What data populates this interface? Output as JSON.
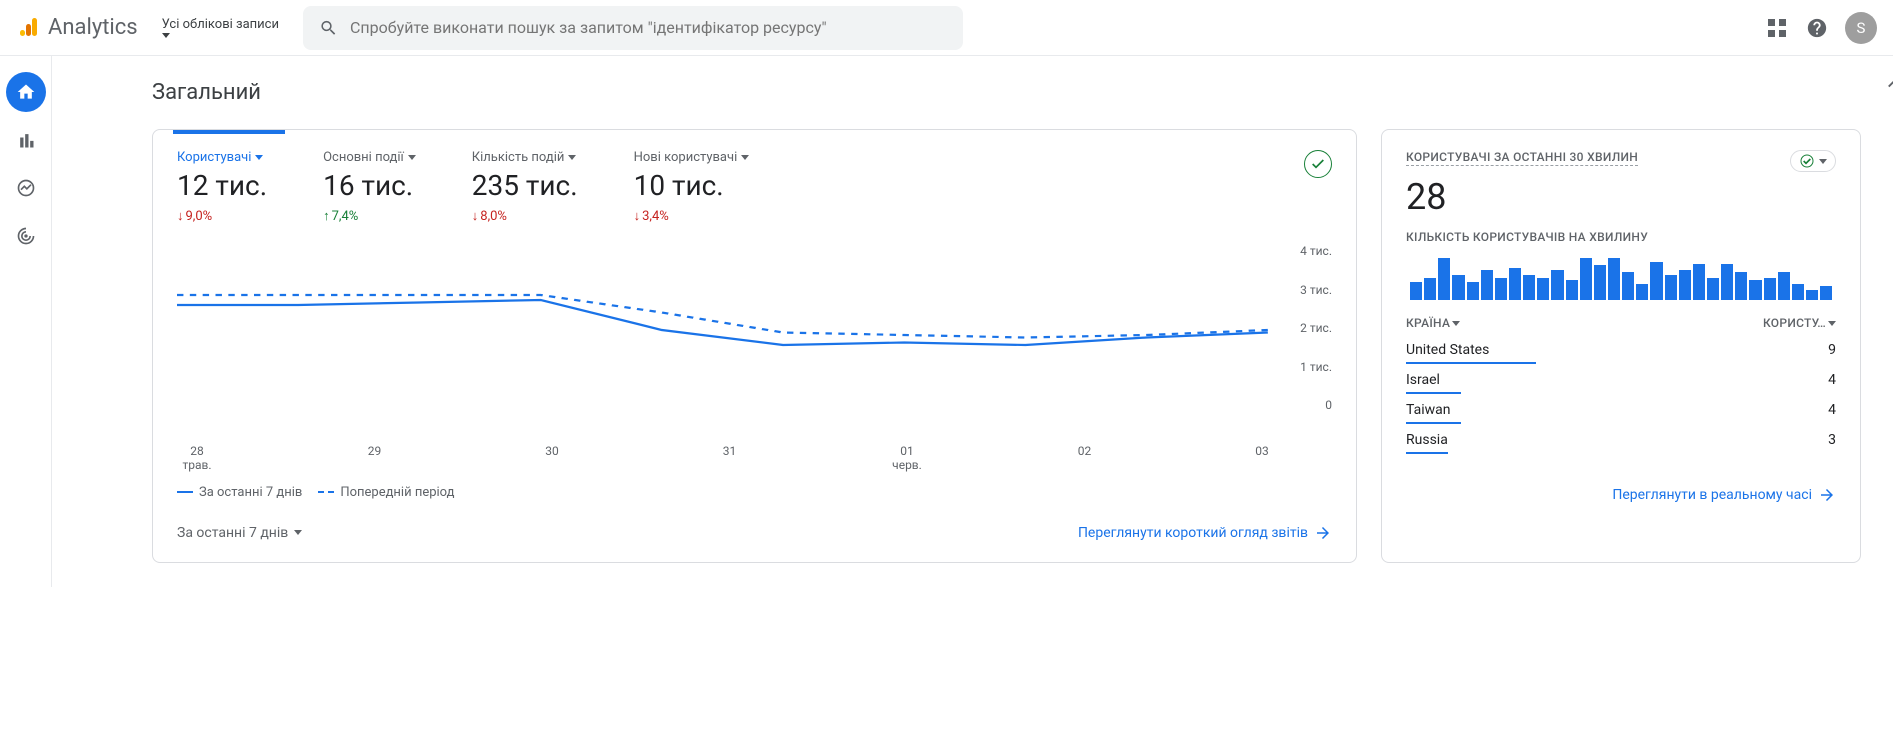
{
  "header": {
    "brand": "Analytics",
    "account_label": "Усі облікові записи",
    "search_placeholder": "Спробуйте виконати пошук за запитом \"ідентифікатор ресурсу\"",
    "avatar_initial": "S"
  },
  "page": {
    "title": "Загальний"
  },
  "metrics": [
    {
      "label": "Користувачі",
      "value": "12 тис.",
      "delta": "9,0%",
      "dir": "down",
      "active": true
    },
    {
      "label": "Основні події",
      "value": "16 тис.",
      "delta": "7,4%",
      "dir": "up",
      "active": false
    },
    {
      "label": "Кількість подій",
      "value": "235 тис.",
      "delta": "8,0%",
      "dir": "down",
      "active": false
    },
    {
      "label": "Нові користувачі",
      "value": "10 тис.",
      "delta": "3,4%",
      "dir": "down",
      "active": false
    }
  ],
  "chart_data": {
    "type": "line",
    "ylabel": "",
    "ylim": [
      0,
      4000
    ],
    "y_ticks": [
      "4 тис.",
      "3 тис.",
      "2 тис.",
      "1 тис.",
      "0"
    ],
    "x_labels": [
      {
        "top": "28",
        "bot": "трав."
      },
      {
        "top": "29",
        "bot": ""
      },
      {
        "top": "30",
        "bot": ""
      },
      {
        "top": "31",
        "bot": ""
      },
      {
        "top": "01",
        "bot": "черв."
      },
      {
        "top": "02",
        "bot": ""
      },
      {
        "top": "03",
        "bot": ""
      }
    ],
    "series": [
      {
        "name": "За останні 7 днів",
        "style": "solid",
        "values": [
          2700,
          2700,
          2750,
          2800,
          2200,
          1900,
          1950,
          1900,
          2050,
          2150
        ]
      },
      {
        "name": "Попередній період",
        "style": "dashed",
        "values": [
          2900,
          2900,
          2900,
          2900,
          2550,
          2150,
          2100,
          2050,
          2100,
          2200
        ]
      }
    ]
  },
  "legend": {
    "current": "За останні 7 днів",
    "previous": "Попередній період"
  },
  "footer_main": {
    "selector": "За останні 7 днів",
    "link": "Переглянути короткий огляд звітів"
  },
  "realtime": {
    "title": "КОРИСТУВАЧІ ЗА ОСТАННІ 30 ХВИЛИН",
    "value": "28",
    "subtitle": "КІЛЬКІСТЬ КОРИСТУВАЧІВ НА ХВИЛИНУ",
    "mini_bars": [
      18,
      22,
      42,
      25,
      18,
      30,
      22,
      32,
      25,
      22,
      30,
      20,
      42,
      35,
      42,
      28,
      16,
      38,
      25,
      30,
      36,
      22,
      36,
      28,
      20,
      22,
      28,
      16,
      10,
      14
    ],
    "col_country": "КРАЇНА",
    "col_users": "КОРИСТУ…",
    "rows": [
      {
        "name": "United States",
        "value": "9",
        "bar": 130
      },
      {
        "name": "Israel",
        "value": "4",
        "bar": 55
      },
      {
        "name": "Taiwan",
        "value": "4",
        "bar": 55
      },
      {
        "name": "Russia",
        "value": "3",
        "bar": 42
      }
    ],
    "link": "Переглянути в реальному часі"
  }
}
